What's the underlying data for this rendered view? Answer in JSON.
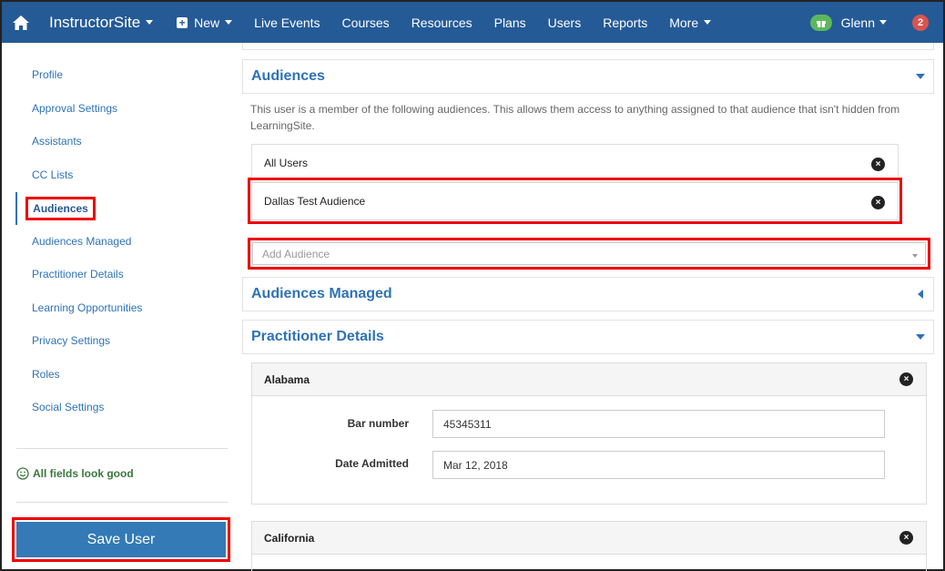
{
  "nav": {
    "brand": "InstructorSite",
    "items": [
      {
        "label": "New"
      },
      {
        "label": "Live Events"
      },
      {
        "label": "Courses"
      },
      {
        "label": "Resources"
      },
      {
        "label": "Plans"
      },
      {
        "label": "Users"
      },
      {
        "label": "Reports"
      },
      {
        "label": "More"
      }
    ],
    "user": "Glenn",
    "notifications": "2"
  },
  "sidebar": {
    "items": [
      {
        "label": "Profile"
      },
      {
        "label": "Approval Settings"
      },
      {
        "label": "Assistants"
      },
      {
        "label": "CC Lists"
      },
      {
        "label": "Audiences"
      },
      {
        "label": "Audiences Managed"
      },
      {
        "label": "Practitioner Details"
      },
      {
        "label": "Learning Opportunities"
      },
      {
        "label": "Privacy Settings"
      },
      {
        "label": "Roles"
      },
      {
        "label": "Social Settings"
      }
    ],
    "status": "All fields look good",
    "save_label": "Save User"
  },
  "audiences": {
    "title": "Audiences",
    "description": "This user is a member of the following audiences. This allows them access to anything assigned to that audience that isn't hidden from LearningSite.",
    "list": [
      {
        "label": "All Users"
      },
      {
        "label": "Dallas Test Audience"
      }
    ],
    "add_placeholder": "Add Audience"
  },
  "audiences_managed": {
    "title": "Audiences Managed"
  },
  "practitioner": {
    "title": "Practitioner Details",
    "states": [
      {
        "name": "Alabama",
        "fields": [
          {
            "label": "Bar number",
            "value": "45345311"
          },
          {
            "label": "Date Admitted",
            "value": "Mar 12, 2018"
          }
        ]
      },
      {
        "name": "California"
      }
    ]
  },
  "colors": {
    "nav_bg": "#245a96",
    "link": "#2e72b7",
    "highlight": "#e00000",
    "save_bg": "#337ab7"
  }
}
